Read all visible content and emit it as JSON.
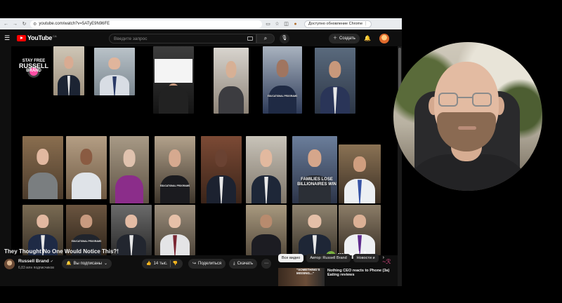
{
  "browser": {
    "url": "youtube.com/watch?v=5ATyE9N96FE",
    "update_button": "Доступно обновление Chrome",
    "icons": [
      "back-icon",
      "forward-icon",
      "reload-icon",
      "tab-icon",
      "bookmark-star-icon",
      "extension-icon",
      "profile-icon",
      "menu-icon"
    ]
  },
  "youtube": {
    "logo_text": "YouTube",
    "region_code": "CA",
    "search_placeholder": "Введите запрос",
    "create_label": "Создать"
  },
  "video": {
    "overlay_logo": {
      "line1": "STAY FREE",
      "line2": "RUSSELL",
      "line3": "BRAND"
    },
    "families_caption": "FAMILIES LOSE BILLIONAIRES WIN",
    "small_captions": [
      "EDUCATIONAL PROGRAMS",
      "EDUCATIONAL PROGRAMS",
      "EDUCATIONAL PROGRAMS"
    ],
    "rumble_text": "rumble"
  },
  "watch": {
    "title": "They Thought No One Would Notice This?!",
    "channel_name": "Russell Brand",
    "subscribers": "6,83 млн подписчиков",
    "subscribe_label": "Вы подписаны",
    "likes": "14 тыс.",
    "share_label": "Поделиться",
    "download_label": "Скачать"
  },
  "sidebar": {
    "chips": [
      "Все видео",
      "Автор: Russell Brand",
      "Новости и"
    ],
    "recommendation": {
      "thumb_text": "\"SOMETHING'S MISSING...\"",
      "title": "Nothing CEO reacts to Phone (3a) Eating reviews"
    }
  }
}
